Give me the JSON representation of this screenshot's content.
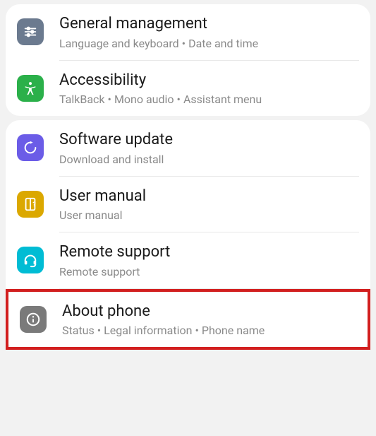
{
  "card1": {
    "item1": {
      "title": "General management",
      "sub": [
        "Language and keyboard",
        "Date and time"
      ]
    },
    "item2": {
      "title": "Accessibility",
      "sub": [
        "TalkBack",
        "Mono audio",
        "Assistant menu"
      ]
    }
  },
  "card2": {
    "item1": {
      "title": "Software update",
      "sub": "Download and install"
    },
    "item2": {
      "title": "User manual",
      "sub": "User manual"
    },
    "item3": {
      "title": "Remote support",
      "sub": "Remote support"
    },
    "item4": {
      "title": "About phone",
      "sub": [
        "Status",
        "Legal information",
        "Phone name"
      ]
    }
  },
  "sep": "•"
}
